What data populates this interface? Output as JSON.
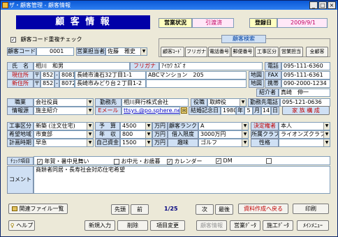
{
  "window": {
    "title": "ザ・顧客管理 - 顧客情報"
  },
  "header": {
    "title": "顧 客 情 報",
    "status_label": "営業状況",
    "status_value": "引渡済",
    "regdate_label": "登録日",
    "regdate_value": "2009/9/1"
  },
  "dupcheck": {
    "label": "顧客コード重複チェック"
  },
  "search": {
    "title": "顧客検索",
    "buttons": [
      "顧客ｺｰﾄﾞ",
      "フリガナ",
      "電話番号",
      "郵便番号",
      "工事区分",
      "営業担当",
      "全顧客"
    ]
  },
  "customer": {
    "code_label": "顧客コード",
    "code_value": "0001",
    "rep_label": "営業担当者",
    "rep_value": "佐藤　雅史",
    "name_label": "氏　名",
    "name_value": "相川　和男",
    "kana_label": "フリガナ",
    "kana_value": "ｱｲｶﾜ ｶｽﾞｵ",
    "phone_label": "電話",
    "phone_value": "095-111-6360",
    "addr_label": "現住所",
    "zip_mark": "〒",
    "zip1": "852",
    "zip1b": "8081",
    "addr1": "長崎市清石32丁目1-1",
    "bldg1": "ABCマンション　205",
    "map_label": "地図",
    "fax_label": "FAX",
    "fax_value": "095-111-6361",
    "new_addr_label": "新住所",
    "zip2": "852",
    "zip2b": "8072",
    "addr2": "長崎市みどり台２丁目1-2",
    "mobile_label": "携帯",
    "mobile_value": "090-2000-1234",
    "referrer_label": "紹介者",
    "referrer_value": "真崎　伸一",
    "job_label": "職業",
    "job_value": "会社役員",
    "workplace_label": "勤務先",
    "workplace_value": "相川興行株式会社",
    "position_label": "役職",
    "position_value": "取締役",
    "workphone_label": "勤務先電話",
    "workphone_value": "095-121-0636",
    "source_label": "情報源",
    "source_value": "施主紹介",
    "email_label": "Eメール",
    "email_value": "ttsys.@po.sphere.ne",
    "anniv_label": "結婚記念日",
    "anniv_year": "1980",
    "year_unit": "年",
    "anniv_month": "5",
    "month_unit": "月",
    "anniv_day": "14",
    "day_unit": "日",
    "family_label": "家 族 構 成"
  },
  "project": {
    "work_label": "工事区分",
    "work_value": "新築 (注文住宅)",
    "budget_label": "予　算",
    "budget_value": "4500",
    "unit": "万円",
    "rank_label": "顧客ランク",
    "rank_value": "A",
    "decider_label": "決定権者",
    "decider_value": "本人",
    "area_label": "希望地域",
    "area_value": "市東部",
    "income_label": "年　収",
    "income_value": "800",
    "loan_label": "借入限度",
    "loan_value": "3000万円",
    "club_label": "所属クラブ",
    "club_value": "ライオンズクラブ",
    "timing_label": "計画時期",
    "timing_value": "早急",
    "equity_label": "自己資金",
    "equity_value": "1500",
    "hobby_label": "趣味",
    "hobby_value": "ゴルフ",
    "personality_label": "性格",
    "personality_value": ""
  },
  "checks": {
    "label": "ﾁｪｯｸ項目",
    "items": [
      {
        "label": "年賀・暑中見舞い",
        "checked": true
      },
      {
        "label": "お中元・お歳暮",
        "checked": false
      },
      {
        "label": "カレンダー",
        "checked": true
      },
      {
        "label": "DM",
        "checked": true
      }
    ]
  },
  "comment": {
    "label": "コメント",
    "value": "商餅者同居・長寿社会対応住宅希望"
  },
  "nav": {
    "related": "関連ファイル一覧",
    "first": "先頭",
    "prev": "前",
    "position": "1/25",
    "next": "次",
    "last": "最後",
    "report": "資料作成へ戻る",
    "print": "印刷"
  },
  "bottom": {
    "help": "ヘルプ",
    "new": "新規入力",
    "delete": "削除",
    "edit": "項目変更",
    "cust_info": "顧客情報",
    "sales_data": "営業ﾃﾞｰﾀ",
    "const_data": "施工ﾃﾞｰﾀ",
    "main_menu": "ﾒｲﾝﾒﾆｭｰ"
  }
}
